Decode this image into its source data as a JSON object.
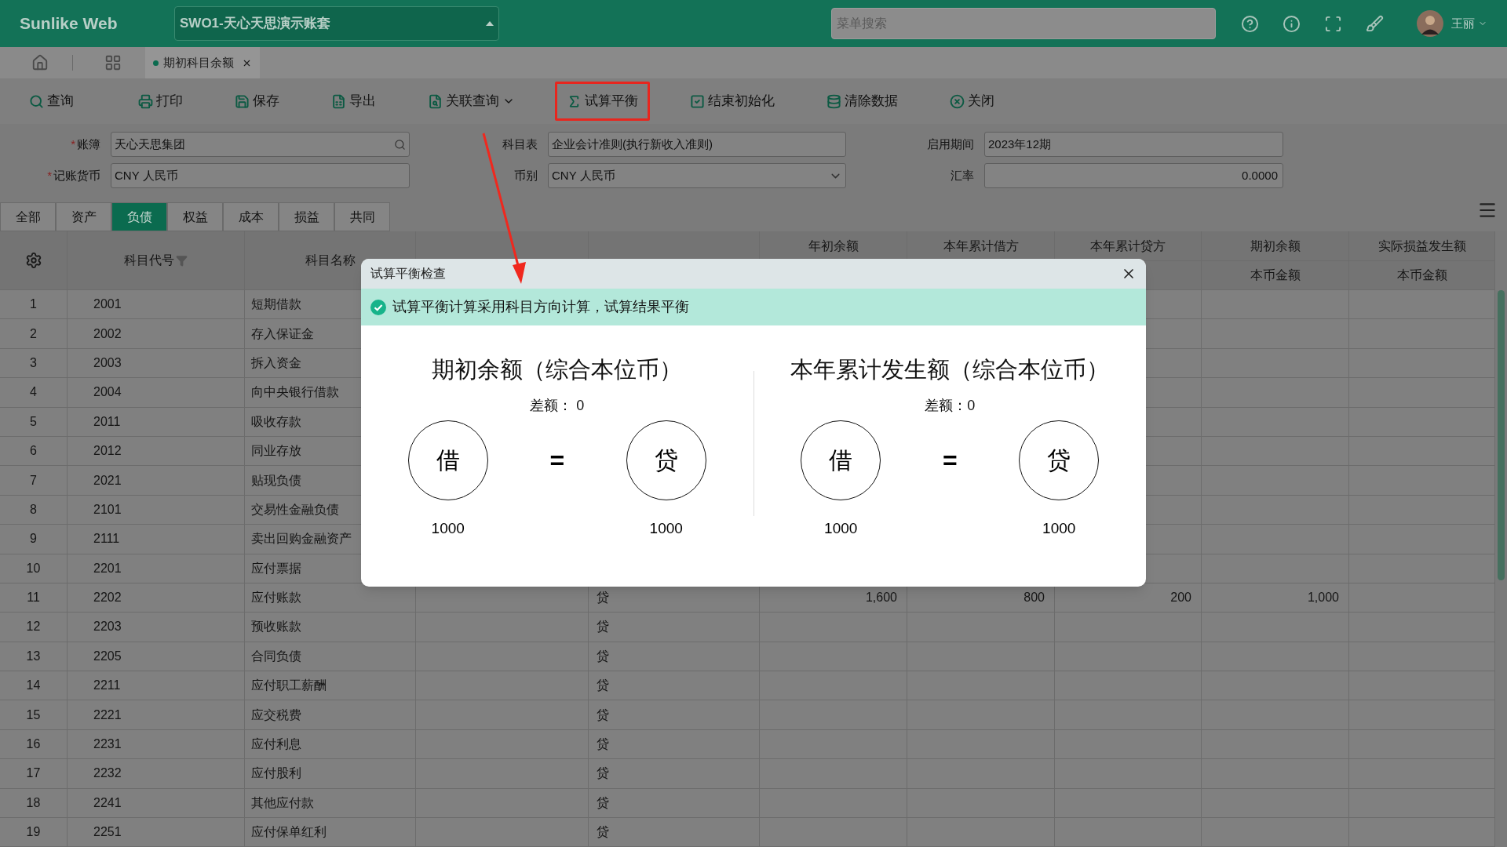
{
  "top_bar": {
    "brand": "Sunlike Web",
    "account_set": "SWO1-天心天思演示账套",
    "search_placeholder": "菜单搜索",
    "user": "王丽"
  },
  "page_tabs": [
    {
      "label": "期初科目余额",
      "selected": true
    }
  ],
  "toolbar": [
    {
      "kind": "search",
      "label": "查询",
      "highlighted": false
    },
    {
      "kind": "print",
      "label": "打印",
      "highlighted": false
    },
    {
      "kind": "save",
      "label": "保存",
      "highlighted": false
    },
    {
      "kind": "export",
      "label": "导出",
      "highlighted": false
    },
    {
      "kind": "query",
      "label": "关联查询",
      "highlighted": false
    },
    {
      "kind": "balance",
      "label": "试算平衡",
      "highlighted": true
    },
    {
      "kind": "finish",
      "label": "结束初始化",
      "highlighted": false
    },
    {
      "kind": "clear",
      "label": "清除数据",
      "highlighted": false
    },
    {
      "kind": "close",
      "label": "关闭",
      "highlighted": false
    }
  ],
  "form": [
    {
      "marker": "*",
      "label": "账簿",
      "value": "天心天思集团",
      "kind": "lookup"
    },
    {
      "label": "科目表",
      "value": "企业会计准则(执行新收入准则)",
      "kind": "text"
    },
    {
      "label": "启用期间",
      "value": "2023年12期",
      "kind": "text"
    },
    {
      "marker": "*",
      "label": "记账货币",
      "value": "CNY 人民币",
      "kind": "text"
    },
    {
      "label": "币别",
      "value": "CNY 人民币",
      "kind": "select"
    },
    {
      "label": "汇率",
      "value": "0.0000",
      "kind": "number"
    }
  ],
  "category_tabs": [
    {
      "label": "全部",
      "selected": false
    },
    {
      "label": "资产",
      "selected": false
    },
    {
      "label": "负债",
      "selected": true
    },
    {
      "label": "权益",
      "selected": false
    },
    {
      "label": "成本",
      "selected": false
    },
    {
      "label": "损益",
      "selected": false
    },
    {
      "label": "共同",
      "selected": false
    }
  ],
  "table": {
    "key_columns": [
      {
        "label": "科目代号",
        "filter": true
      },
      {
        "label": "科目名称",
        "filter": false
      }
    ],
    "amount_columns": [
      {
        "label": "年初余额"
      },
      {
        "label": "本年累计借方"
      },
      {
        "label": "本年累计贷方"
      },
      {
        "label": "期初余额",
        "sub": "本币金额"
      },
      {
        "label": "实际损益发生额",
        "sub": "本币金额"
      }
    ],
    "rows": [
      {
        "no": "1",
        "code": "2001",
        "name": "短期借款"
      },
      {
        "no": "2",
        "code": "2002",
        "name": "存入保证金"
      },
      {
        "no": "3",
        "code": "2003",
        "name": "拆入资金"
      },
      {
        "no": "4",
        "code": "2004",
        "name": "向中央银行借款"
      },
      {
        "no": "5",
        "code": "2011",
        "name": "吸收存款"
      },
      {
        "no": "6",
        "code": "2012",
        "name": "同业存放"
      },
      {
        "no": "7",
        "code": "2021",
        "name": "贴现负债"
      },
      {
        "no": "8",
        "code": "2101",
        "name": "交易性金融负债"
      },
      {
        "no": "9",
        "code": "2111",
        "name": "卖出回购金融资产"
      },
      {
        "no": "10",
        "code": "2201",
        "name": "应付票据"
      },
      {
        "no": "11",
        "code": "2202",
        "name": "应付账款",
        "direction": "贷",
        "amounts": [
          "1,600",
          "800",
          "200",
          "1,000"
        ]
      },
      {
        "no": "12",
        "code": "2203",
        "name": "预收账款",
        "direction": "贷"
      },
      {
        "no": "13",
        "code": "2205",
        "name": "合同负债",
        "direction": "贷"
      },
      {
        "no": "14",
        "code": "2211",
        "name": "应付职工薪酬",
        "direction": "贷"
      },
      {
        "no": "15",
        "code": "2221",
        "name": "应交税费",
        "direction": "贷"
      },
      {
        "no": "16",
        "code": "2231",
        "name": "应付利息",
        "direction": "贷"
      },
      {
        "no": "17",
        "code": "2232",
        "name": "应付股利",
        "direction": "贷"
      },
      {
        "no": "18",
        "code": "2241",
        "name": "其他应付款",
        "direction": "贷"
      },
      {
        "no": "19",
        "code": "2251",
        "name": "应付保单红利",
        "direction": "贷"
      }
    ]
  },
  "dialog": {
    "title": "试算平衡检查",
    "message": "试算平衡计算采用科目方向计算，试算结果平衡",
    "panels": [
      {
        "title": "期初余额（综合本位币）",
        "difference": "差额： 0",
        "debit": "借",
        "equals": "=",
        "credit": "贷",
        "debit_value": "1000",
        "credit_value": "1000"
      },
      {
        "title": "本年累计发生额（综合本位币）",
        "difference": "差额：0",
        "debit": "借",
        "equals": "=",
        "credit": "贷",
        "debit_value": "1000",
        "credit_value": "1000"
      }
    ]
  }
}
